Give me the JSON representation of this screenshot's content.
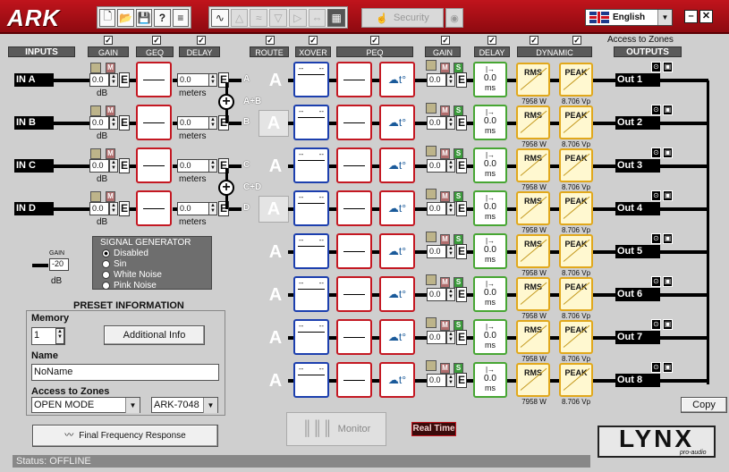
{
  "app": {
    "logo": "ARK",
    "language": "English"
  },
  "toolbar": {
    "security_label": "Security"
  },
  "headers": {
    "inputs": "INPUTS",
    "gain": "GAIN",
    "geq": "GEQ",
    "delay": "DELAY",
    "route": "ROUTE",
    "xover": "XOVER",
    "peq": "PEQ",
    "gain2": "GAIN",
    "delay2": "DELAY",
    "dynamic": "DYNAMIC",
    "outputs": "OUTPUTS",
    "access_zones": "Access to Zones"
  },
  "inputs": [
    {
      "label": "IN A",
      "gain": "0.0",
      "gain_unit": "dB",
      "delay": "0.0",
      "delay_unit": "meters",
      "route": "A"
    },
    {
      "label": "IN B",
      "gain": "0.0",
      "gain_unit": "dB",
      "delay": "0.0",
      "delay_unit": "meters",
      "route": "B"
    },
    {
      "label": "IN C",
      "gain": "0.0",
      "gain_unit": "dB",
      "delay": "0.0",
      "delay_unit": "meters",
      "route": "C"
    },
    {
      "label": "IN D",
      "gain": "0.0",
      "gain_unit": "dB",
      "delay": "0.0",
      "delay_unit": "meters",
      "route": "D"
    }
  ],
  "sums": {
    "ab": "A+B",
    "cd": "C+D"
  },
  "outputs": [
    {
      "route": "A",
      "gain": "0.0",
      "delay": "0.0",
      "delay_unit": "ms",
      "rms": "RMS",
      "rms_val": "7958 W",
      "peak": "PEAK",
      "peak_val": "8.706 Vp",
      "label": "Out 1"
    },
    {
      "route": "A",
      "gain": "0.0",
      "delay": "0.0",
      "delay_unit": "ms",
      "rms": "RMS",
      "rms_val": "7958 W",
      "peak": "PEAK",
      "peak_val": "8.706 Vp",
      "label": "Out 2"
    },
    {
      "route": "A",
      "gain": "0.0",
      "delay": "0.0",
      "delay_unit": "ms",
      "rms": "RMS",
      "rms_val": "7958 W",
      "peak": "PEAK",
      "peak_val": "8.706 Vp",
      "label": "Out 3"
    },
    {
      "route": "A",
      "gain": "0.0",
      "delay": "0.0",
      "delay_unit": "ms",
      "rms": "RMS",
      "rms_val": "7958 W",
      "peak": "PEAK",
      "peak_val": "8.706 Vp",
      "label": "Out 4"
    },
    {
      "route": "A",
      "gain": "0.0",
      "delay": "0.0",
      "delay_unit": "ms",
      "rms": "RMS",
      "rms_val": "7958 W",
      "peak": "PEAK",
      "peak_val": "8.706 Vp",
      "label": "Out 5"
    },
    {
      "route": "A",
      "gain": "0.0",
      "delay": "0.0",
      "delay_unit": "ms",
      "rms": "RMS",
      "rms_val": "7958 W",
      "peak": "PEAK",
      "peak_val": "8.706 Vp",
      "label": "Out 6"
    },
    {
      "route": "A",
      "gain": "0.0",
      "delay": "0.0",
      "delay_unit": "ms",
      "rms": "RMS",
      "rms_val": "7958 W",
      "peak": "PEAK",
      "peak_val": "8.706 Vp",
      "label": "Out 7"
    },
    {
      "route": "A",
      "gain": "0.0",
      "delay": "0.0",
      "delay_unit": "ms",
      "rms": "RMS",
      "rms_val": "7958 W",
      "peak": "PEAK",
      "peak_val": "8.706 Vp",
      "label": "Out 8"
    }
  ],
  "xover_dashes": "--",
  "button_labels": {
    "m": "M",
    "s": "S",
    "e": "E"
  },
  "generator": {
    "gain_label": "GAIN",
    "gain_value": "-20",
    "gain_unit": "dB",
    "title": "SIGNAL GENERATOR",
    "options": [
      "Disabled",
      "Sin",
      "White Noise",
      "Pink Noise"
    ],
    "selected": "Disabled"
  },
  "preset": {
    "title": "PRESET INFORMATION",
    "memory_label": "Memory",
    "memory_value": "1",
    "additional_info": "Additional Info",
    "name_label": "Name",
    "name_value": "NoName",
    "zones_label": "Access to Zones",
    "zones_mode": "OPEN MODE",
    "device": "ARK-7048"
  },
  "buttons": {
    "final_response": "Final Frequency Response",
    "monitor": "Monitor",
    "real_time": "Real Time",
    "copy": "Copy"
  },
  "status": {
    "text": "Status:  OFFLINE"
  },
  "brand": {
    "name": "LYNX",
    "sub": "pro-audio"
  },
  "colors": {
    "brand_red": "#c41822",
    "xover_blue": "#1c3fae",
    "delay_green": "#47a633",
    "dynamic_amber": "#e1a81c"
  }
}
